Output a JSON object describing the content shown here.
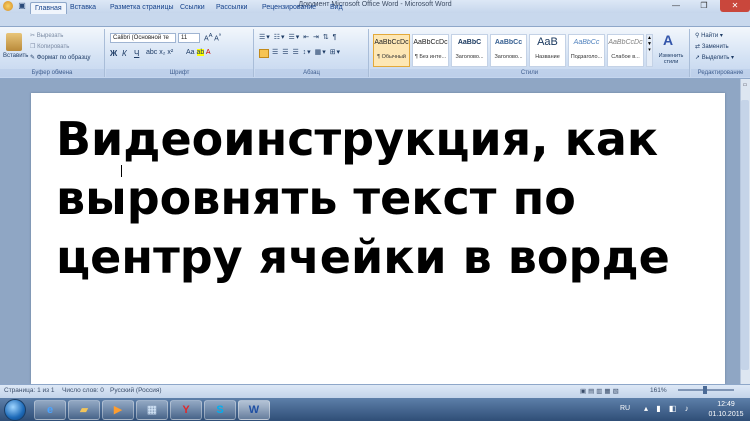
{
  "window": {
    "title": "Документ Microsoft Office Word  -  Microsoft Word"
  },
  "tabs": [
    "Главная",
    "Вставка",
    "Разметка страницы",
    "Ссылки",
    "Рассылки",
    "Рецензирование",
    "Вид"
  ],
  "clipboard": {
    "paste": "Вставить",
    "cut": "Вырезать",
    "copy": "Копировать",
    "format_painter": "Формат по образцу",
    "label": "Буфер обмена"
  },
  "font": {
    "name": "Calibri (Основной те",
    "size": "11",
    "bold": "Ж",
    "italic": "К",
    "underline": "Ч",
    "label": "Шрифт"
  },
  "paragraph": {
    "label": "Абзац"
  },
  "styles": {
    "items": [
      {
        "preview": "AaBbCcDc",
        "name": "¶ Обычный"
      },
      {
        "preview": "AaBbCcDc",
        "name": "¶ Без инте..."
      },
      {
        "preview": "AaBbC",
        "name": "Заголово..."
      },
      {
        "preview": "AaBbCc",
        "name": "Заголово..."
      },
      {
        "preview": "AaB",
        "name": "Название"
      },
      {
        "preview": "AaBbCc",
        "name": "Подзаголо..."
      },
      {
        "preview": "AaBbCcDc",
        "name": "Слабое в..."
      }
    ],
    "change_styles": "Изменить стили",
    "label": "Стили"
  },
  "editing": {
    "find": "Найти",
    "replace": "Заменить",
    "select": "Выделить",
    "label": "Редактирование"
  },
  "document": {
    "text": "Видеоинструкция, как\nвыровнять текст по\nцентру ячейки в ворде"
  },
  "status": {
    "page": "Страница: 1 из 1",
    "words": "Число слов: 0",
    "language": "Русский (Россия)",
    "zoom": "161%"
  },
  "taskbar": {
    "lang": "RU",
    "time": "12:49",
    "date": "01.10.2015"
  }
}
